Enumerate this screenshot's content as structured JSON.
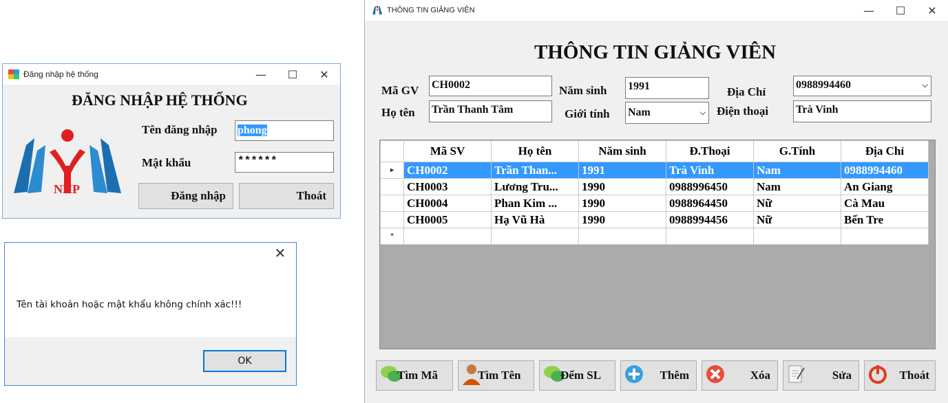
{
  "login_window": {
    "title": "Đăng nhập hệ thống",
    "heading": "ĐĂNG NHẬP HỆ THỐNG",
    "username_label": "Tên đăng nhập",
    "username_value": "phong",
    "password_label": "Mật khẩu",
    "password_value": "******",
    "login_button": "Đăng nhập",
    "exit_button": "Thoát",
    "logo_text": "NHP",
    "controls": {
      "minimize": "—",
      "maximize": "☐",
      "close": "✕"
    }
  },
  "message_box": {
    "message": "Tên tài khoản hoặc mật khẩu không chính xác!!!",
    "ok_button": "OK",
    "close": "✕"
  },
  "main_window": {
    "title": "THÔNG TIN GIẢNG VIÊN",
    "heading": "THÔNG TIN GIẢNG VIÊN",
    "controls": {
      "minimize": "—",
      "maximize": "☐",
      "close": "✕"
    },
    "form": {
      "ma_gv_label": "Mã GV",
      "ma_gv_value": "CH0002",
      "ho_ten_label": "Họ tên",
      "ho_ten_value": "Trần Thanh Tâm",
      "nam_sinh_label": "Năm sinh",
      "nam_sinh_value": "1991",
      "gioi_tinh_label": "Giới tính",
      "gioi_tinh_value": "Nam",
      "dia_chi_label": "Địa Chỉ",
      "dia_chi_value": "0988994460",
      "dien_thoai_label": "Điện thoại",
      "dien_thoai_value": "Trà Vinh"
    },
    "grid": {
      "columns": [
        "Mã SV",
        "Họ tên",
        "Năm sinh",
        "Đ.Thoại",
        "G.Tính",
        "Địa Chỉ"
      ],
      "rows": [
        [
          "CH0002",
          "Trần Than...",
          "1991",
          "Trà Vinh",
          "Nam",
          "0988994460"
        ],
        [
          "CH0003",
          "Lương Tru...",
          "1990",
          "0988996450",
          "Nam",
          "An Giang"
        ],
        [
          "CH0004",
          "Phan Kim ...",
          "1990",
          "0988964450",
          "Nữ",
          "Cà Mau"
        ],
        [
          "CH0005",
          "Hạ Vũ Hà",
          "1990",
          "0988994456",
          "Nữ",
          "Bến Tre"
        ]
      ],
      "selected_row": 0,
      "current_row_marker": "▸",
      "new_row_marker": "*"
    },
    "buttons": [
      {
        "label": "Tìm Mã",
        "icon": "chat-bubble-icon"
      },
      {
        "label": "Tìm Tên",
        "icon": "user-icon"
      },
      {
        "label": "Đếm SL",
        "icon": "chat-bubble-icon"
      },
      {
        "label": "Thêm",
        "icon": "add-icon"
      },
      {
        "label": "Xóa",
        "icon": "delete-icon"
      },
      {
        "label": "Sửa",
        "icon": "edit-icon"
      },
      {
        "label": "Thoát",
        "icon": "power-icon"
      }
    ],
    "colors": {
      "selection": "#3399ff",
      "grid_background": "#ababab",
      "window_background": "#f0f0f0"
    }
  }
}
